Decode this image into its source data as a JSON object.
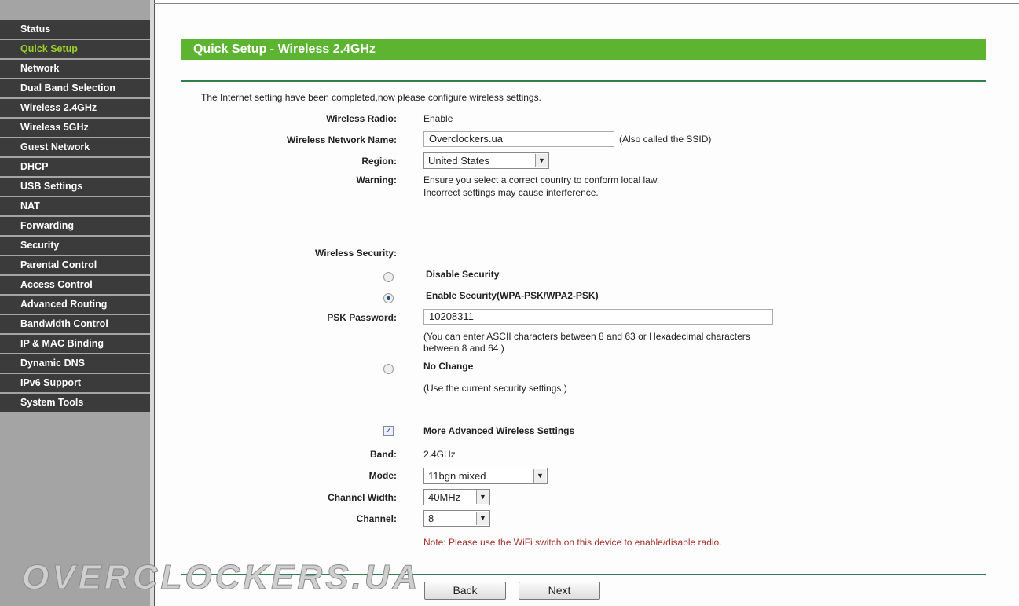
{
  "sidebar": {
    "items": [
      "Status",
      "Quick Setup",
      "Network",
      "Dual Band Selection",
      "Wireless 2.4GHz",
      "Wireless 5GHz",
      "Guest Network",
      "DHCP",
      "USB Settings",
      "NAT",
      "Forwarding",
      "Security",
      "Parental Control",
      "Access Control",
      "Advanced Routing",
      "Bandwidth Control",
      "IP & MAC Binding",
      "Dynamic DNS",
      "IPv6 Support",
      "System Tools"
    ],
    "active": "Quick Setup"
  },
  "header": {
    "title": "Quick Setup - Wireless 2.4GHz"
  },
  "form": {
    "intro": "The Internet setting have been completed,now please configure wireless settings.",
    "radio_label": "Wireless Radio:",
    "radio_value": "Enable",
    "ssid_label": "Wireless Network Name:",
    "ssid_value": "Overclockers.ua",
    "ssid_hint": "(Also called the SSID)",
    "region_label": "Region:",
    "region_value": "United States",
    "warning_label": "Warning:",
    "warning_line1": "Ensure you select a correct country to conform local law.",
    "warning_line2": "Incorrect settings may cause interference.",
    "security_label": "Wireless Security:",
    "disable_security": "Disable Security",
    "enable_security": "Enable Security(WPA-PSK/WPA2-PSK)",
    "psk_label": "PSK Password:",
    "psk_value": "10208311",
    "psk_hint1": "(You can enter ASCII characters between 8 and 63 or Hexadecimal characters",
    "psk_hint2": "between 8 and 64.)",
    "no_change": "No Change",
    "no_change_hint": "(Use the current security settings.)",
    "advanced": "More Advanced Wireless Settings",
    "band_label": "Band:",
    "band_value": "2.4GHz",
    "mode_label": "Mode:",
    "mode_value": "11bgn mixed",
    "width_label": "Channel Width:",
    "width_value": "40MHz",
    "channel_label": "Channel:",
    "channel_value": "8",
    "note": "Note: Please use the WiFi switch on this device to enable/disable radio."
  },
  "buttons": {
    "back": "Back",
    "next": "Next"
  },
  "watermark": "OVERCLOCKERS.UA",
  "colors": {
    "accent": "#5cb431",
    "sidebar": "#3b3b3b",
    "active": "#9ccf2c"
  }
}
